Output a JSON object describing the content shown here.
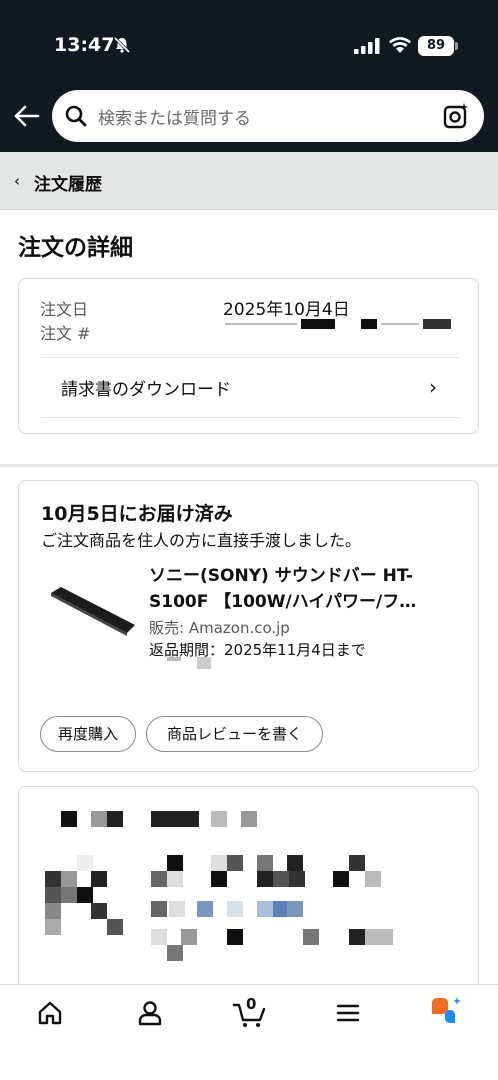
{
  "status_bar": {
    "time": "13:47",
    "battery": "89"
  },
  "search": {
    "placeholder": "検索または質問する"
  },
  "breadcrumb": {
    "chevron": "‹",
    "label": "注文履歴"
  },
  "page_title": "注文の詳細",
  "order_info": {
    "date_label": "注文日",
    "date_value": "2025年10月4日",
    "number_label": "注文 #",
    "invoice_label": "請求書のダウンロード",
    "chevron": "›"
  },
  "shipment": {
    "status_title": "10月5日にお届け済み",
    "status_detail": "ご注文商品を住人の方に直接手渡しました。",
    "product_title_line1": "ソニー(SONY) サウンドバー HT-",
    "product_title_line2": "S100F 【100W/ハイパワー/フ…",
    "seller": "販売: Amazon.co.jp",
    "return_window": "返品期間：2025年11月4日まで",
    "buttons": {
      "buy_again": "再度購入",
      "write_review": "商品レビューを書く"
    }
  },
  "bottom_nav": {
    "icons": [
      "home-icon",
      "account-icon",
      "cart-icon",
      "menu-icon",
      "rufus-icon"
    ],
    "cart_count": "0"
  },
  "colors": {
    "header_bg": "#131921",
    "breadcrumb_bg": "#e3e6e6",
    "rufus_orange": "#f36e22",
    "rufus_blue": "#1a8cff"
  }
}
